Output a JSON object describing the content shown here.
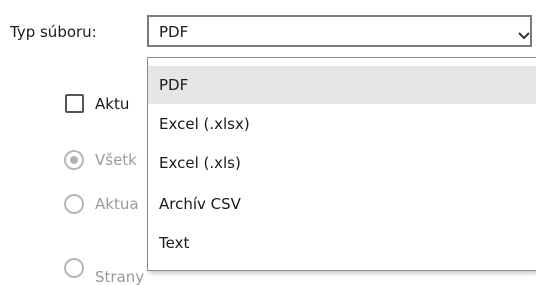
{
  "file_type": {
    "label": "Typ súboru:",
    "selected_value": "PDF",
    "chevron_icon": "chevron-down-icon"
  },
  "options": {
    "checkbox_label": "Aktu",
    "radio_all_label": "Všetk",
    "radio_current_label": "Aktua",
    "radio_pages_label": "Strany"
  },
  "dropdown": {
    "items": [
      {
        "label": "PDF",
        "selected": true
      },
      {
        "label": "Excel (.xlsx)",
        "selected": false
      },
      {
        "label": "Excel (.xls)",
        "selected": false
      },
      {
        "label": "Archív CSV",
        "selected": false
      },
      {
        "label": "Text",
        "selected": false
      }
    ],
    "highlight_color": "#e5e5e5"
  }
}
